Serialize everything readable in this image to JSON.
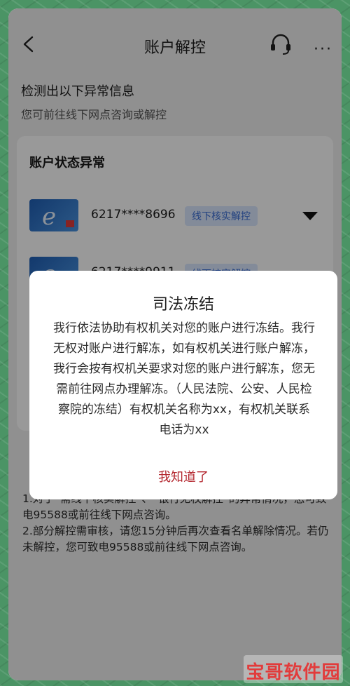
{
  "header": {
    "title": "账户解控",
    "back_icon": "chevron-left-icon",
    "support_icon": "headset-icon",
    "more_label": "···"
  },
  "notice": {
    "title": "检测出以下异常信息",
    "subtitle": "您可前往线下网点咨询或解控"
  },
  "status_card": {
    "title": "账户状态异常",
    "accounts": [
      {
        "number": "6217****8696",
        "status": "线下核实解控"
      },
      {
        "number": "6217****9911",
        "status": "线下核实解控"
      }
    ]
  },
  "footnotes": [
    "1.对于“需线下核实解控”、“银行无权解控”的异常情况，您可致电95588或前往线下网点咨询。",
    "2.部分解控需审核，请您15分钟后再次查看名单解除情况。若仍未解控，您可致电95588或前往线下网点咨询。"
  ],
  "modal": {
    "title": "司法冻结",
    "body": "我行依法协助有权机关对您的账户进行冻结。我行无权对账户进行解冻，如有权机关进行账户解冻，我行会按有权机关要求对您的账户进行解冻，您无需前往网点办理解冻。（人民法院、公安、人民检察院的冻结）有权机关名称为xx，有权机关联系电话为xx",
    "confirm_label": "我知道了"
  },
  "watermark": {
    "text": "宝哥软件园"
  },
  "colors": {
    "accent_red": "#b3262e",
    "badge_blue": "#3b6fd6"
  }
}
